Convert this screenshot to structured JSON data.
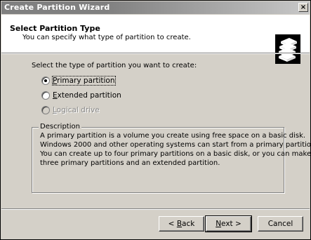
{
  "window": {
    "title": "Create Partition Wizard",
    "close_glyph": "×"
  },
  "header": {
    "title": "Select Partition Type",
    "subtitle": "You can specify what type of partition to create."
  },
  "prompt": "Select the type of partition you want to create:",
  "options": [
    {
      "mnemonic": "P",
      "rest": "rimary partition",
      "checked": true,
      "enabled": true
    },
    {
      "mnemonic": "E",
      "rest": "xtended partition",
      "checked": false,
      "enabled": true
    },
    {
      "mnemonic": "L",
      "rest": "ogical drive",
      "checked": false,
      "enabled": false
    }
  ],
  "description": {
    "legend": "Description",
    "lines": [
      "A primary partition is a volume you create using free space on a basic disk.",
      "Windows 2000 and other operating systems can start from a primary partition.",
      "You can create up to four primary partitions on a basic disk, or you can make",
      "three primary partitions and an extended partition."
    ]
  },
  "buttons": {
    "back": {
      "prefix": "< ",
      "mnemonic": "B",
      "rest": "ack"
    },
    "next": {
      "mnemonic": "N",
      "rest": "ext >"
    },
    "cancel": {
      "label": "Cancel"
    }
  },
  "icons": {
    "header": "disk-stack-icon"
  }
}
